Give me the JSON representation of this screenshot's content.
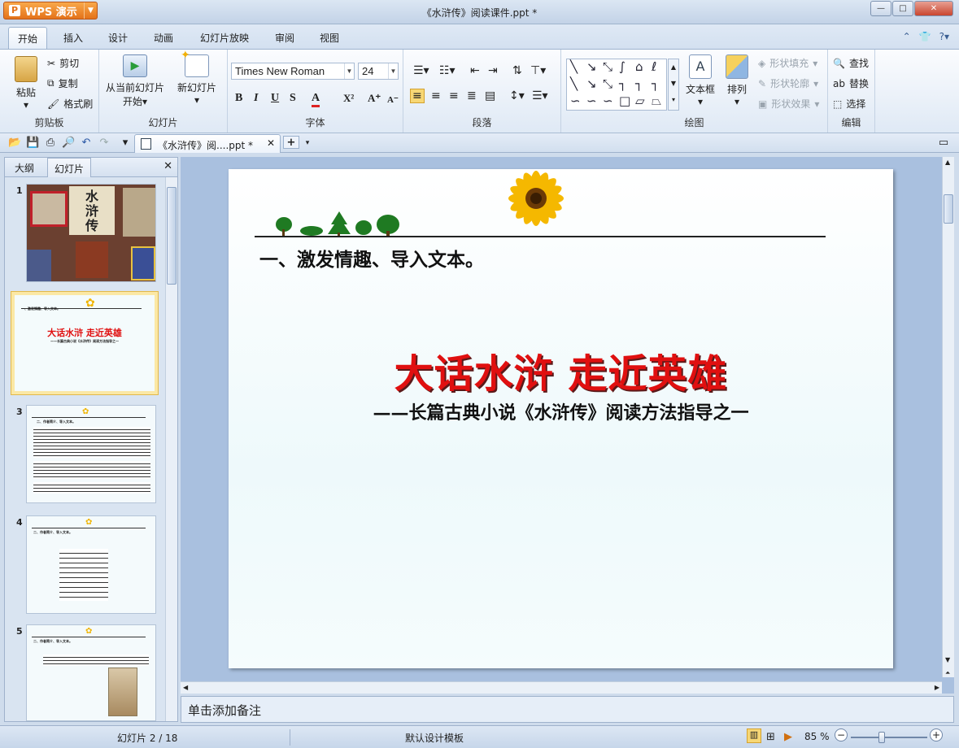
{
  "app": {
    "button_label": "WPS 演示",
    "window_title": "《水浒传》阅读课件.ppt *"
  },
  "window_controls": {
    "minimize": "—",
    "restore": "□",
    "close": "✕"
  },
  "menu_tabs": [
    "开始",
    "插入",
    "设计",
    "动画",
    "幻灯片放映",
    "审阅",
    "视图"
  ],
  "ribbon": {
    "clipboard": {
      "paste": "粘贴",
      "cut": "剪切",
      "copy": "复制",
      "format_painter": "格式刷",
      "group": "剪贴板"
    },
    "slides": {
      "from_current_line1": "从当前幻灯片",
      "from_current_line2": "开始",
      "new_slide": "新幻灯片",
      "group": "幻灯片"
    },
    "font": {
      "family": "Times New Roman",
      "size": "24",
      "group": "字体",
      "bold": "B",
      "italic": "I",
      "underline": "U",
      "shadow": "S",
      "color": "A",
      "superscript": "X²",
      "grow": "A⁺",
      "shrink": "A⁻"
    },
    "paragraph": {
      "group": "段落"
    },
    "drawing": {
      "textbox": "文本框",
      "arrange": "排列",
      "fill": "形状填充",
      "outline": "形状轮廓",
      "effect": "形状效果",
      "group": "绘图"
    },
    "editing": {
      "find": "查找",
      "replace": "替换",
      "select": "选择",
      "group": "编辑"
    }
  },
  "document_tab": {
    "label": "《水浒传》阅....ppt *"
  },
  "panel": {
    "tab_outline": "大纲",
    "tab_slides": "幻灯片"
  },
  "thumbnails": [
    {
      "num": "1"
    },
    {
      "num": "2",
      "heading": "一、激发情趣、导入文本。",
      "title": "大话水浒 走近英雄",
      "subtitle": "——长篇古典小说《水浒传》阅读方法指导之一"
    },
    {
      "num": "3",
      "heading": "二、作者简介、导入文本。"
    },
    {
      "num": "4",
      "heading": "二、作者简介、导入文本。"
    },
    {
      "num": "5",
      "heading": "二、作者简介、导入文本。"
    }
  ],
  "slide": {
    "heading": "一、激发情趣、导入文本。",
    "title": "大话水浒 走近英雄",
    "subtitle": "——长篇古典小说《水浒传》阅读方法指导之一"
  },
  "notes_placeholder": "单击添加备注",
  "status": {
    "slide_counter": "幻灯片 2 / 18",
    "template": "默认设计模板",
    "zoom": "85 %"
  }
}
